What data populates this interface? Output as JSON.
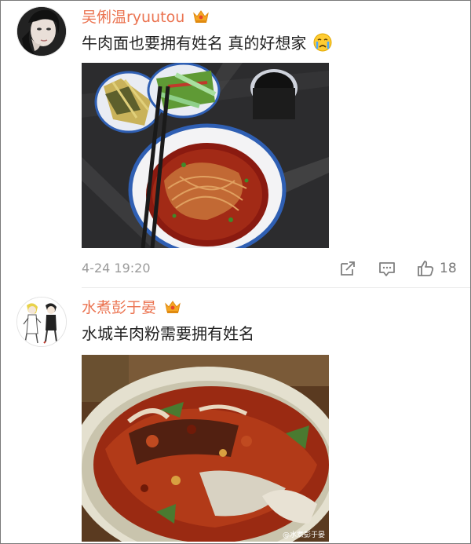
{
  "comments": [
    {
      "username": "吴俐温ryuutou",
      "text": "牛肉面也要拥有姓名 真的好想家",
      "emoji": "crying-face-emoji",
      "timestamp": "4-24 19:20",
      "likes": "18",
      "badge": "crown-badge-icon"
    },
    {
      "username": "水煮彭于晏",
      "text": "水城羊肉粉需要拥有姓名",
      "watermark": "@水煮彭于晏",
      "badge": "crown-badge-icon"
    }
  ],
  "colors": {
    "username": "#eb7350",
    "text": "#222222",
    "meta": "#9a9a9a",
    "icon": "#808080"
  }
}
